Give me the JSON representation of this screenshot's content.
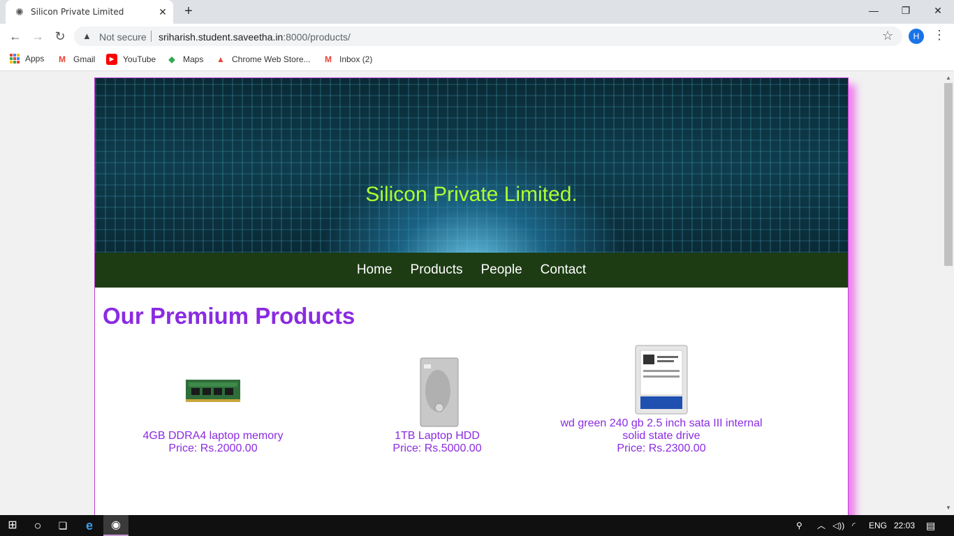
{
  "browser": {
    "tab_title": "Silicon Private Limited",
    "tab_close": "✕",
    "new_tab": "+",
    "security_label": "Not secure",
    "url_host": "sriharish.student.saveetha.in",
    "url_path": ":8000/products/",
    "avatar_letter": "H",
    "window_controls": {
      "minimize": "—",
      "restore": "❐",
      "close": "✕"
    }
  },
  "bookmarks": [
    {
      "label": "Apps",
      "icon": "apps-grid-icon"
    },
    {
      "label": "Gmail",
      "icon": "gmail-icon",
      "glyph": "M",
      "color": "#ea4335"
    },
    {
      "label": "YouTube",
      "icon": "youtube-icon",
      "glyph": "▶",
      "color": "#ff0000"
    },
    {
      "label": "Maps",
      "icon": "maps-icon",
      "glyph": "◆",
      "color": "#34a853"
    },
    {
      "label": "Chrome Web Store...",
      "icon": "webstore-icon",
      "glyph": "▲",
      "color": "#e8453c"
    },
    {
      "label": "Inbox (2)",
      "icon": "gmail-icon",
      "glyph": "M",
      "color": "#ea4335"
    }
  ],
  "site": {
    "banner_title": "Silicon Private Limited.",
    "nav": [
      "Home",
      "Products",
      "People",
      "Contact"
    ],
    "heading": "Our Premium Products",
    "products": [
      {
        "name": "4GB DDRA4 laptop memory",
        "price": "Price: Rs.2000.00"
      },
      {
        "name": "1TB Laptop HDD",
        "price": "Price: Rs.5000.00"
      },
      {
        "name": "wd green 240 gb 2.5 inch sata III internal solid state drive",
        "price": "Price: Rs.2300.00"
      }
    ]
  },
  "taskbar": {
    "language": "ENG",
    "time": "22:03"
  },
  "colors": {
    "heading": "#8a2be2",
    "banner_title": "#adff2f",
    "nav_bg": "#1d3c14",
    "frame_shadow": "#ee82ee"
  }
}
